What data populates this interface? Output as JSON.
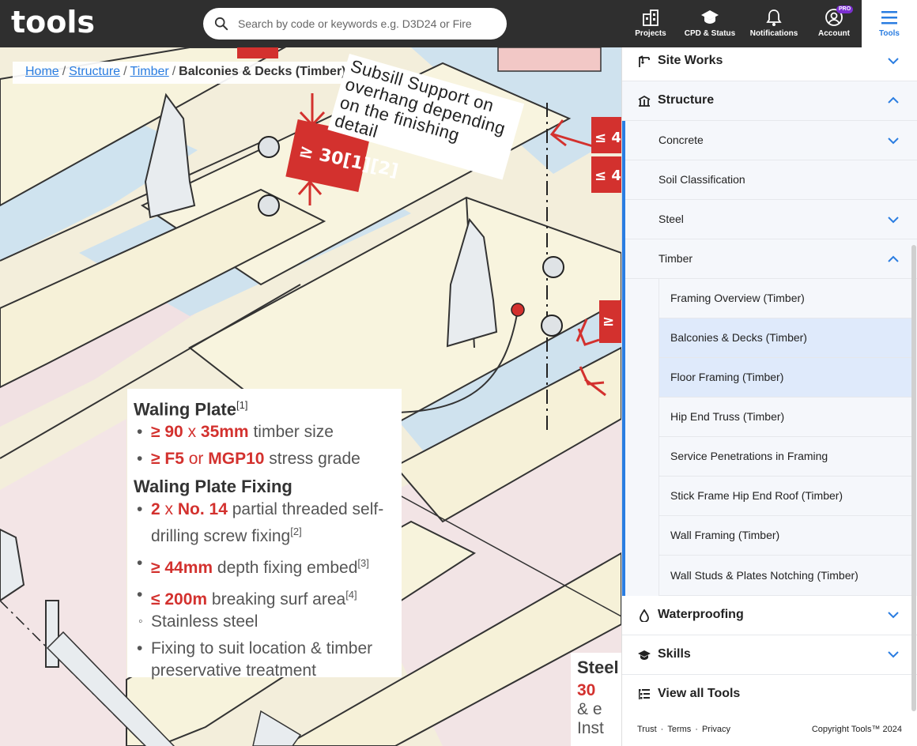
{
  "header": {
    "logo_text": "tools",
    "search": {
      "placeholder": "Search by code or keywords e.g. D3D24 or Fire",
      "value": ""
    },
    "nav": [
      {
        "label": "Projects",
        "icon": "projects-icon"
      },
      {
        "label": "CPD & Status",
        "icon": "graduation-cap-icon"
      },
      {
        "label": "Notifications",
        "icon": "bell-icon"
      },
      {
        "label": "Account",
        "icon": "user-icon",
        "badge": "PRO"
      },
      {
        "label": "Tools",
        "icon": "menu-icon",
        "active": true
      }
    ]
  },
  "breadcrumb": {
    "items": [
      "Home",
      "Structure",
      "Timber"
    ],
    "current": "Balconies & Decks (Timber)"
  },
  "illustration": {
    "subsill_callout": "Subsill Support on overhang depending on the finishing detail",
    "dimension_label": "≥ 30[1][2]",
    "right_labels": [
      "≤ 4",
      "≤ 4",
      "≥"
    ],
    "note": {
      "waling_plate_title": "Waling Plate",
      "waling_plate_ref": "[1]",
      "timber_size": {
        "min": "≥ 90",
        "x": "x",
        "dim": "35mm",
        "text": "timber size"
      },
      "stress_grade": {
        "min": "≥ F5",
        "or": "or",
        "grade": "MGP10",
        "text": "stress grade"
      },
      "fixing_title": "Waling Plate Fixing",
      "screw": {
        "qty": "2",
        "x": "x",
        "type": "No. 14",
        "text": "partial threaded self-drilling screw fixing",
        "ref": "[2]"
      },
      "embed": {
        "min": "≥ 44mm",
        "text": "depth fixing embed",
        "ref": "[3]"
      },
      "surf": {
        "max": "≤ 200m",
        "text": "breaking surf area",
        "ref": "[4]"
      },
      "stainless": "Stainless steel",
      "treatment": "Fixing to suit location & timber preservative treatment"
    },
    "steel_card": {
      "title": "Steel",
      "value": "30",
      "line2": "& e",
      "line3": "Inst"
    }
  },
  "sidebar": {
    "top_items": [
      {
        "label": "Site Works",
        "icon": "crane-icon",
        "expanded": false
      }
    ],
    "structure": {
      "label": "Structure",
      "icon": "structure-icon",
      "expanded": true,
      "children": [
        {
          "label": "Concrete",
          "expandable": true,
          "expanded": false
        },
        {
          "label": "Soil Classification",
          "expandable": false
        },
        {
          "label": "Steel",
          "expandable": true,
          "expanded": false
        },
        {
          "label": "Timber",
          "expandable": true,
          "expanded": true
        }
      ],
      "timber_items": [
        {
          "label": "Framing Overview (Timber)",
          "highlighted": false
        },
        {
          "label": "Balconies & Decks (Timber)",
          "highlighted": true
        },
        {
          "label": "Floor Framing (Timber)",
          "highlighted": true
        },
        {
          "label": "Hip End Truss (Timber)",
          "highlighted": false
        },
        {
          "label": "Service Penetrations in Framing",
          "highlighted": false
        },
        {
          "label": "Stick Frame Hip End Roof (Timber)",
          "highlighted": false
        },
        {
          "label": "Wall Framing (Timber)",
          "highlighted": false
        },
        {
          "label": "Wall Studs & Plates Notching (Timber)",
          "highlighted": false
        }
      ]
    },
    "bottom_items": [
      {
        "label": "Waterproofing",
        "icon": "droplet-icon"
      },
      {
        "label": "Skills",
        "icon": "graduation-cap-icon"
      }
    ],
    "view_all": {
      "label": "View all Tools",
      "icon": "list-icon"
    },
    "footer": {
      "links": [
        "Trust",
        "Terms",
        "Privacy"
      ],
      "copyright": "Copyright Tools™ 2024"
    }
  },
  "colors": {
    "topbar": "#2f2f2f",
    "accent": "#2a7de1",
    "warning_red": "#d3312e",
    "highlight": "#dfeafb"
  }
}
